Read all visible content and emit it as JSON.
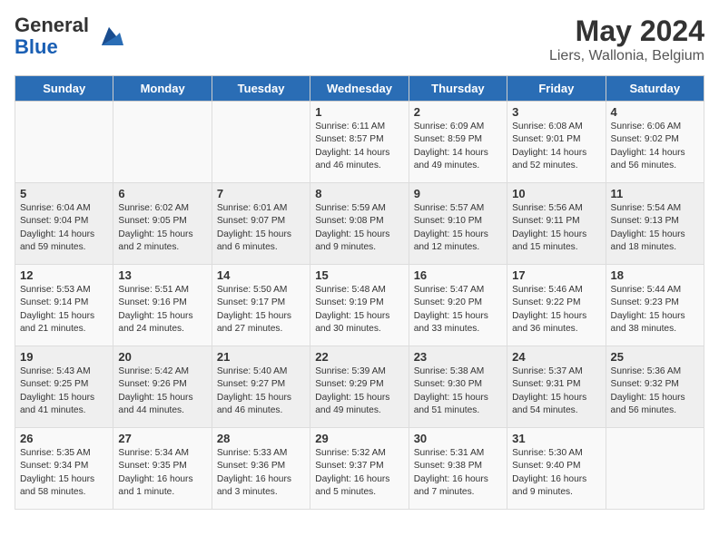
{
  "logo": {
    "general": "General",
    "blue": "Blue"
  },
  "title": "May 2024",
  "subtitle": "Liers, Wallonia, Belgium",
  "days_of_week": [
    "Sunday",
    "Monday",
    "Tuesday",
    "Wednesday",
    "Thursday",
    "Friday",
    "Saturday"
  ],
  "weeks": [
    [
      {
        "day": "",
        "info": ""
      },
      {
        "day": "",
        "info": ""
      },
      {
        "day": "",
        "info": ""
      },
      {
        "day": "1",
        "info": "Sunrise: 6:11 AM\nSunset: 8:57 PM\nDaylight: 14 hours\nand 46 minutes."
      },
      {
        "day": "2",
        "info": "Sunrise: 6:09 AM\nSunset: 8:59 PM\nDaylight: 14 hours\nand 49 minutes."
      },
      {
        "day": "3",
        "info": "Sunrise: 6:08 AM\nSunset: 9:01 PM\nDaylight: 14 hours\nand 52 minutes."
      },
      {
        "day": "4",
        "info": "Sunrise: 6:06 AM\nSunset: 9:02 PM\nDaylight: 14 hours\nand 56 minutes."
      }
    ],
    [
      {
        "day": "5",
        "info": "Sunrise: 6:04 AM\nSunset: 9:04 PM\nDaylight: 14 hours\nand 59 minutes."
      },
      {
        "day": "6",
        "info": "Sunrise: 6:02 AM\nSunset: 9:05 PM\nDaylight: 15 hours\nand 2 minutes."
      },
      {
        "day": "7",
        "info": "Sunrise: 6:01 AM\nSunset: 9:07 PM\nDaylight: 15 hours\nand 6 minutes."
      },
      {
        "day": "8",
        "info": "Sunrise: 5:59 AM\nSunset: 9:08 PM\nDaylight: 15 hours\nand 9 minutes."
      },
      {
        "day": "9",
        "info": "Sunrise: 5:57 AM\nSunset: 9:10 PM\nDaylight: 15 hours\nand 12 minutes."
      },
      {
        "day": "10",
        "info": "Sunrise: 5:56 AM\nSunset: 9:11 PM\nDaylight: 15 hours\nand 15 minutes."
      },
      {
        "day": "11",
        "info": "Sunrise: 5:54 AM\nSunset: 9:13 PM\nDaylight: 15 hours\nand 18 minutes."
      }
    ],
    [
      {
        "day": "12",
        "info": "Sunrise: 5:53 AM\nSunset: 9:14 PM\nDaylight: 15 hours\nand 21 minutes."
      },
      {
        "day": "13",
        "info": "Sunrise: 5:51 AM\nSunset: 9:16 PM\nDaylight: 15 hours\nand 24 minutes."
      },
      {
        "day": "14",
        "info": "Sunrise: 5:50 AM\nSunset: 9:17 PM\nDaylight: 15 hours\nand 27 minutes."
      },
      {
        "day": "15",
        "info": "Sunrise: 5:48 AM\nSunset: 9:19 PM\nDaylight: 15 hours\nand 30 minutes."
      },
      {
        "day": "16",
        "info": "Sunrise: 5:47 AM\nSunset: 9:20 PM\nDaylight: 15 hours\nand 33 minutes."
      },
      {
        "day": "17",
        "info": "Sunrise: 5:46 AM\nSunset: 9:22 PM\nDaylight: 15 hours\nand 36 minutes."
      },
      {
        "day": "18",
        "info": "Sunrise: 5:44 AM\nSunset: 9:23 PM\nDaylight: 15 hours\nand 38 minutes."
      }
    ],
    [
      {
        "day": "19",
        "info": "Sunrise: 5:43 AM\nSunset: 9:25 PM\nDaylight: 15 hours\nand 41 minutes."
      },
      {
        "day": "20",
        "info": "Sunrise: 5:42 AM\nSunset: 9:26 PM\nDaylight: 15 hours\nand 44 minutes."
      },
      {
        "day": "21",
        "info": "Sunrise: 5:40 AM\nSunset: 9:27 PM\nDaylight: 15 hours\nand 46 minutes."
      },
      {
        "day": "22",
        "info": "Sunrise: 5:39 AM\nSunset: 9:29 PM\nDaylight: 15 hours\nand 49 minutes."
      },
      {
        "day": "23",
        "info": "Sunrise: 5:38 AM\nSunset: 9:30 PM\nDaylight: 15 hours\nand 51 minutes."
      },
      {
        "day": "24",
        "info": "Sunrise: 5:37 AM\nSunset: 9:31 PM\nDaylight: 15 hours\nand 54 minutes."
      },
      {
        "day": "25",
        "info": "Sunrise: 5:36 AM\nSunset: 9:32 PM\nDaylight: 15 hours\nand 56 minutes."
      }
    ],
    [
      {
        "day": "26",
        "info": "Sunrise: 5:35 AM\nSunset: 9:34 PM\nDaylight: 15 hours\nand 58 minutes."
      },
      {
        "day": "27",
        "info": "Sunrise: 5:34 AM\nSunset: 9:35 PM\nDaylight: 16 hours\nand 1 minute."
      },
      {
        "day": "28",
        "info": "Sunrise: 5:33 AM\nSunset: 9:36 PM\nDaylight: 16 hours\nand 3 minutes."
      },
      {
        "day": "29",
        "info": "Sunrise: 5:32 AM\nSunset: 9:37 PM\nDaylight: 16 hours\nand 5 minutes."
      },
      {
        "day": "30",
        "info": "Sunrise: 5:31 AM\nSunset: 9:38 PM\nDaylight: 16 hours\nand 7 minutes."
      },
      {
        "day": "31",
        "info": "Sunrise: 5:30 AM\nSunset: 9:40 PM\nDaylight: 16 hours\nand 9 minutes."
      },
      {
        "day": "",
        "info": ""
      }
    ]
  ]
}
